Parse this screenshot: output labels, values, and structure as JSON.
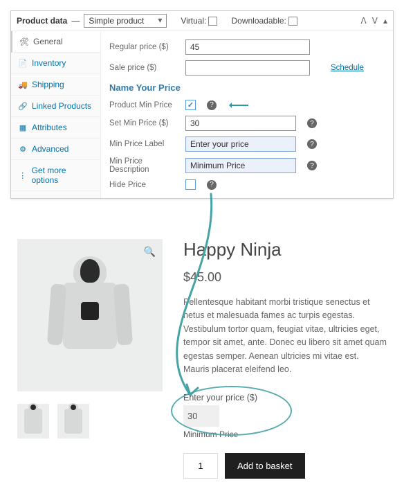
{
  "panel": {
    "title": "Product data",
    "product_type": "Simple product",
    "virtual_label": "Virtual:",
    "downloadable_label": "Downloadable:"
  },
  "tabs": [
    {
      "icon": "🛠",
      "label": "General",
      "active": true
    },
    {
      "icon": "📄",
      "label": "Inventory",
      "active": false
    },
    {
      "icon": "🚚",
      "label": "Shipping",
      "active": false
    },
    {
      "icon": "🔗",
      "label": "Linked Products",
      "active": false
    },
    {
      "icon": "▦",
      "label": "Attributes",
      "active": false
    },
    {
      "icon": "⚙",
      "label": "Advanced",
      "active": false
    },
    {
      "icon": "⋮",
      "label": "Get more options",
      "active": false
    }
  ],
  "form": {
    "regular_price_label": "Regular price ($)",
    "regular_price_value": "45",
    "sale_price_label": "Sale price ($)",
    "sale_price_value": "",
    "schedule_label": "Schedule",
    "section_title": "Name Your Price",
    "pmp_label": "Product Min Price",
    "pmp_checked": true,
    "smp_label": "Set Min Price ($)",
    "smp_value": "30",
    "mpl_label": "Min Price Label",
    "mpl_value": "Enter your price",
    "mpd_label": "Min Price Description",
    "mpd_value": "Minimum Price",
    "hide_label": "Hide Price",
    "hide_checked": false
  },
  "product": {
    "title": "Happy Ninja",
    "price": "$45.00",
    "desc": "Pellentesque habitant morbi tristique senectus et netus et malesuada fames ac turpis egestas. Vestibulum tortor quam, feugiat vitae, ultricies eget, tempor sit amet, ante. Donec eu libero sit amet quam egestas semper. Aenean ultricies mi vitae est. Mauris placerat eleifend leo.",
    "nyp_label": "Enter your price ($)",
    "nyp_value": "30",
    "nyp_min": "Minimum Price",
    "qty": "1",
    "add_to_basket": "Add to basket"
  }
}
